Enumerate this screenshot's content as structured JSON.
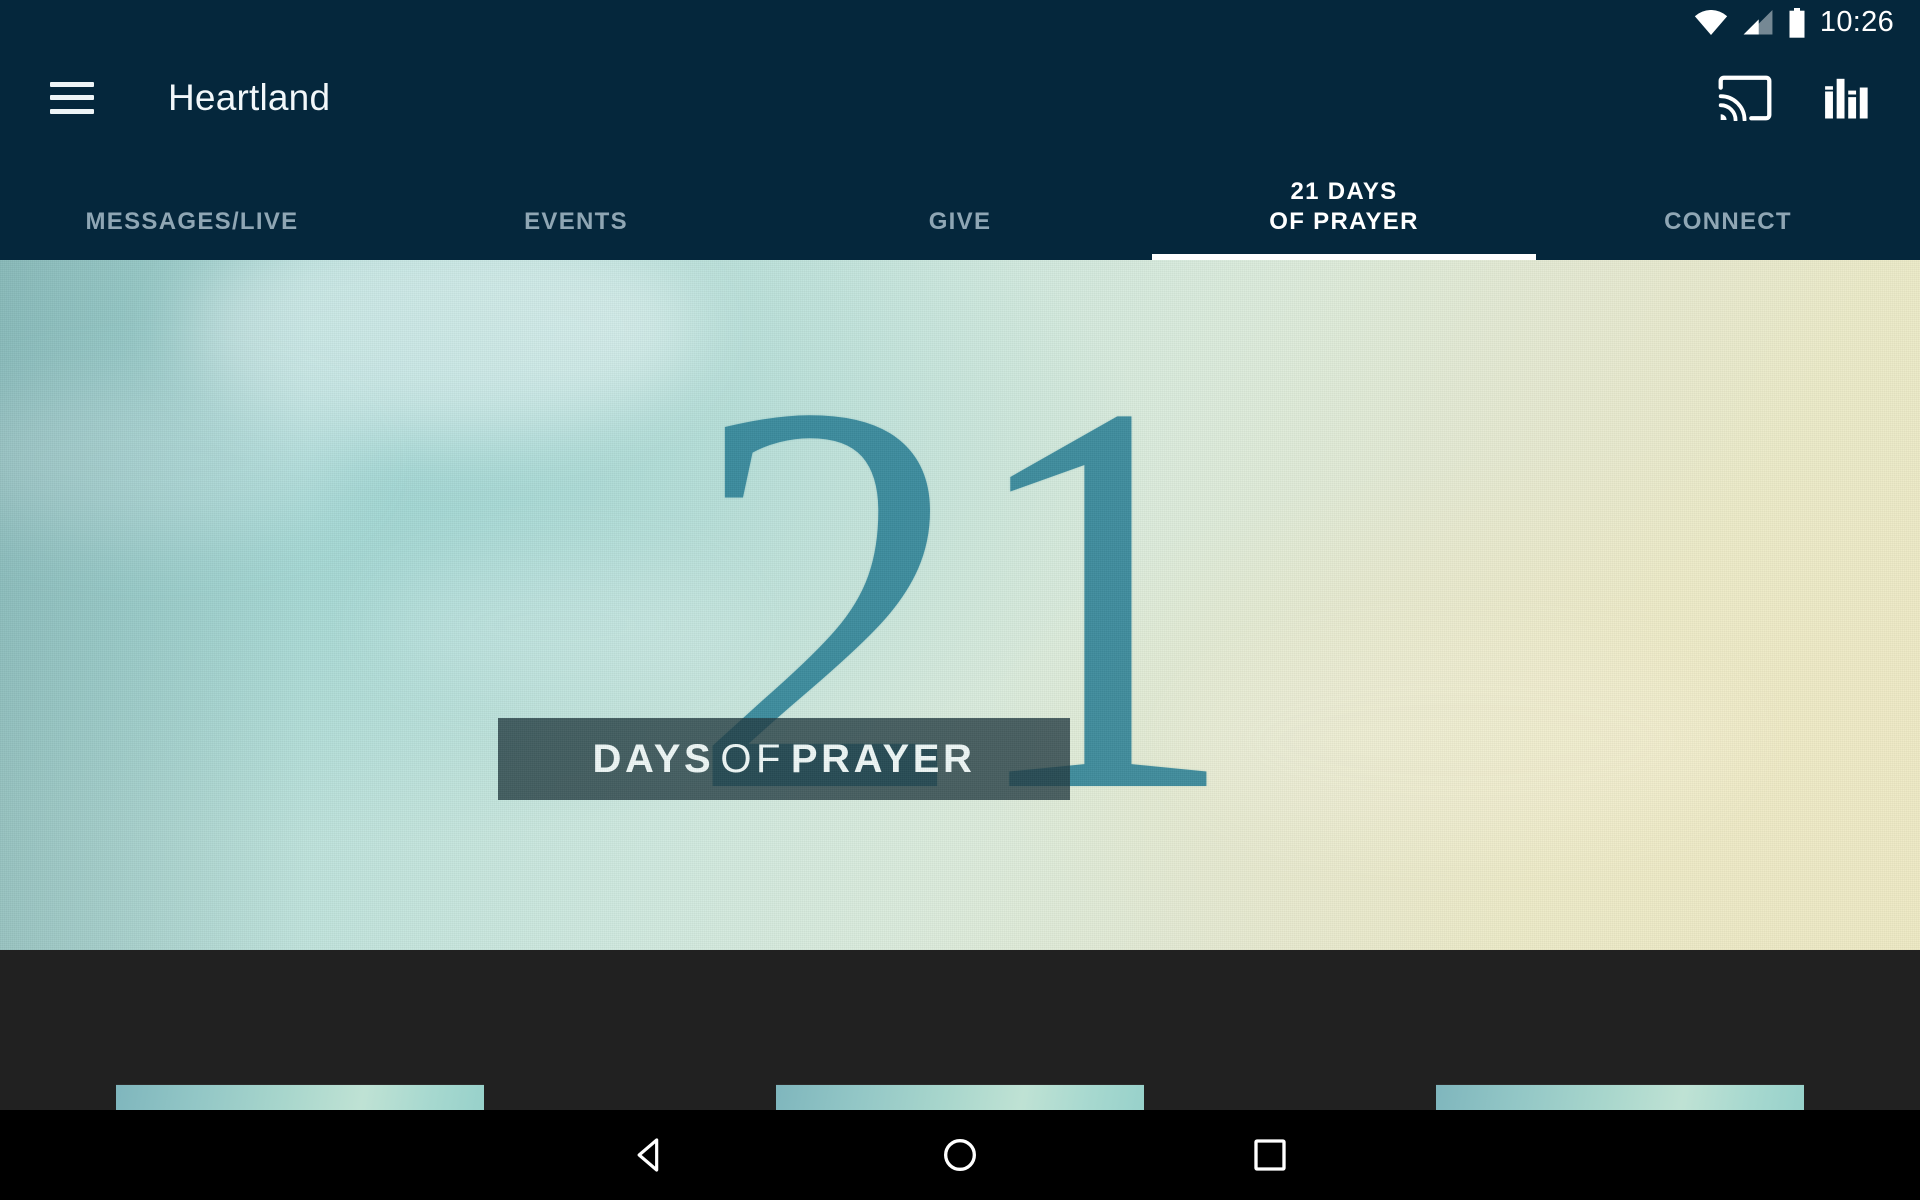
{
  "status_bar": {
    "clock": "10:26",
    "icons": [
      "wifi-icon",
      "cellular-signal-icon",
      "battery-icon"
    ]
  },
  "app_bar": {
    "menu_icon": "hamburger-menu-icon",
    "title": "Heartland",
    "actions": [
      {
        "name": "cast-icon",
        "label": "Cast"
      },
      {
        "name": "equalizer-icon",
        "label": "Equalizer"
      }
    ]
  },
  "tabs": [
    {
      "label": "MESSAGES/LIVE",
      "active": false
    },
    {
      "label": "EVENTS",
      "active": false
    },
    {
      "label": "GIVE",
      "active": false
    },
    {
      "label": "21 DAYS\nOF PRAYER",
      "active": true
    },
    {
      "label": "CONNECT",
      "active": false
    }
  ],
  "hero": {
    "numeral": "21",
    "band_word_1": "DAYS",
    "band_word_2": "OF",
    "band_word_3": "PRAYER"
  },
  "content": {
    "cards": [
      {
        "name": "content-card-1"
      },
      {
        "name": "content-card-2"
      },
      {
        "name": "content-card-3"
      }
    ]
  },
  "nav_bar": {
    "back": "back-triangle-icon",
    "home": "home-circle-icon",
    "recents": "recents-square-icon"
  },
  "colors": {
    "app_bar": "#05273c",
    "active_tab_text": "#ffffff",
    "inactive_tab_text": "#8fa6b4",
    "content_bg": "#212121",
    "hero_numeral": "#2b8196",
    "nav_bar": "#000000"
  }
}
